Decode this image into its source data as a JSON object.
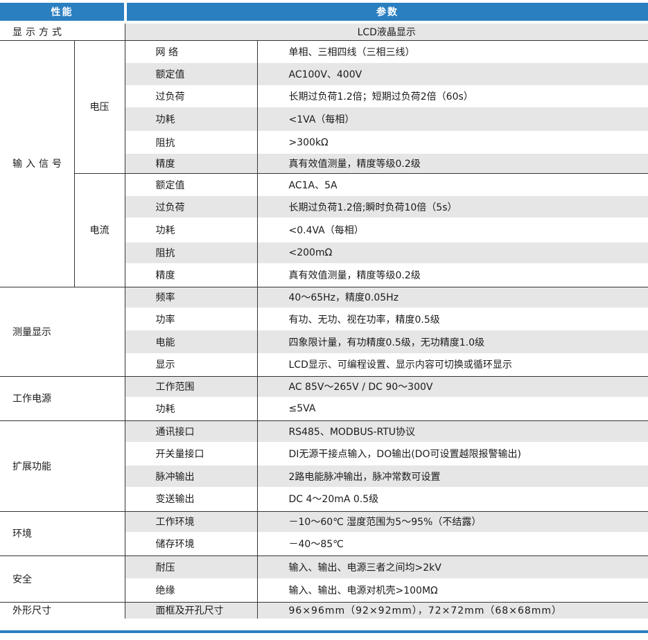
{
  "header": {
    "left": "性能",
    "right": "参数"
  },
  "rows": {
    "display": {
      "label": "显示方式",
      "value": "LCD液晶显示"
    },
    "input": {
      "label": "输入信号",
      "voltage": {
        "label": "电压",
        "items": [
          {
            "k": "网 络",
            "v": "单相、三相四线（三相三线）"
          },
          {
            "k": "额定值",
            "v": "AC100V、400V"
          },
          {
            "k": "过负荷",
            "v": "长期过负荷1.2倍；短期过负荷2倍（60s）"
          },
          {
            "k": "功耗",
            "v": "<1VA（每相）"
          },
          {
            "k": "阻抗",
            "v": ">300kΩ"
          },
          {
            "k": "精度",
            "v": "真有效值测量，精度等级0.2级"
          }
        ]
      },
      "current": {
        "label": "电流",
        "items": [
          {
            "k": "额定值",
            "v": "AC1A、5A"
          },
          {
            "k": "过负荷",
            "v": "长期过负荷1.2倍;瞬时负荷10倍（5s）"
          },
          {
            "k": "功耗",
            "v": "<0.4VA（每相）"
          },
          {
            "k": "阻抗",
            "v": "<200mΩ"
          },
          {
            "k": "精度",
            "v": "真有效值测量，精度等级0.2级"
          }
        ]
      }
    },
    "measure": {
      "label": "测量显示",
      "items": [
        {
          "k": "频率",
          "v": "40～65Hz，精度0.05Hz"
        },
        {
          "k": "功率",
          "v": "有功、无功、视在功率，精度0.5级"
        },
        {
          "k": "电能",
          "v": "四象限计量，有功精度0.5级，无功精度1.0级"
        },
        {
          "k": "显示",
          "v": "LCD显示、可编程设置、显示内容可切换或循环显示"
        }
      ]
    },
    "power": {
      "label": "工作电源",
      "items": [
        {
          "k": "工作范围",
          "v": "AC 85V～265V / DC 90～300V"
        },
        {
          "k": "功耗",
          "v": "≤5VA"
        }
      ]
    },
    "ext": {
      "label": "扩展功能",
      "items": [
        {
          "k": "通讯接口",
          "v": "RS485、MODBUS-RTU协议"
        },
        {
          "k": "开关量接口",
          "v": "DI无源干接点输入，DO输出(DO可设置越限报警输出)"
        },
        {
          "k": "脉冲输出",
          "v": "2路电能脉冲输出，脉冲常数可设置"
        },
        {
          "k": "变送输出",
          "v": "DC 4～20mA 0.5级"
        }
      ]
    },
    "env": {
      "label": "环境",
      "items": [
        {
          "k": "工作环境",
          "v": "－10～60℃  湿度范围为5～95%（不结露）"
        },
        {
          "k": "储存环境",
          "v": "－40～85℃"
        }
      ]
    },
    "safety": {
      "label": "安全",
      "items": [
        {
          "k": "耐压",
          "v": "输入、输出、电源三者之间均>2kV"
        },
        {
          "k": "绝缘",
          "v": "输入、输出、电源对机壳>100MΩ"
        }
      ]
    },
    "size": {
      "label": "外形尺寸",
      "items": [
        {
          "k": "面框及开孔尺寸",
          "v": "96×96mm（92×92mm），72×72mm（68×68mm）"
        }
      ]
    }
  }
}
